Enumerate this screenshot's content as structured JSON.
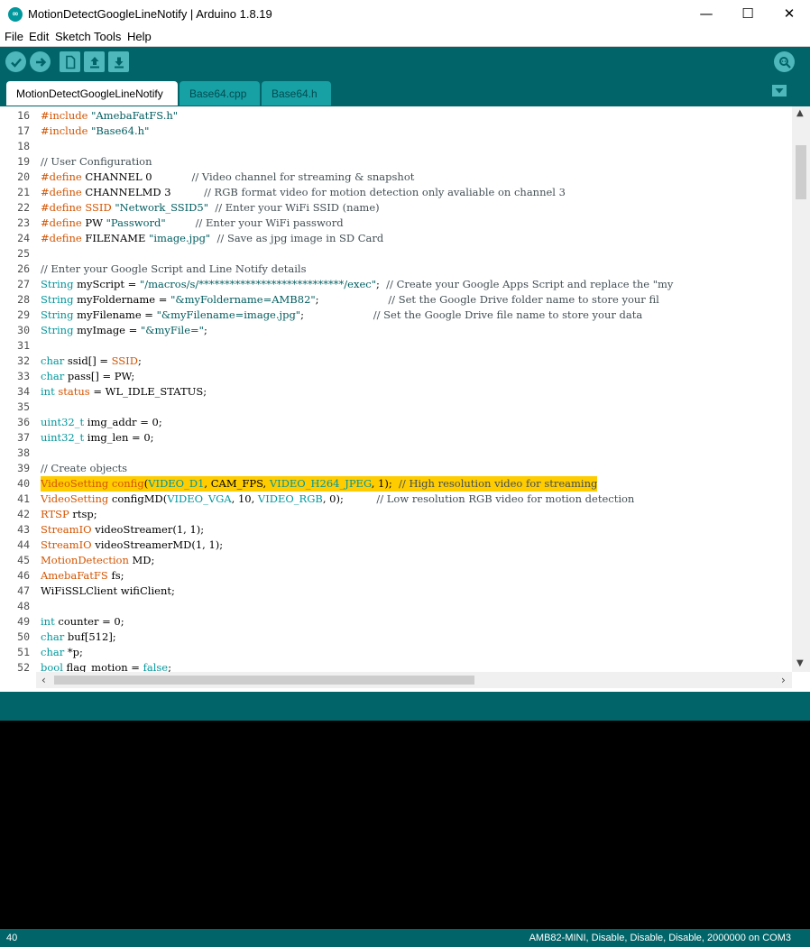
{
  "window": {
    "title": "MotionDetectGoogleLineNotify | Arduino 1.8.19",
    "app_icon_glyph": "∞",
    "minimize_glyph": "—",
    "maximize_glyph": "☐",
    "close_glyph": "✕"
  },
  "menu": [
    "File",
    "Edit",
    "Sketch",
    "Tools",
    "Help"
  ],
  "toolbar": {
    "icons": [
      "verify-icon",
      "upload-icon",
      "new-icon",
      "open-icon",
      "save-icon",
      "serial-monitor-icon"
    ]
  },
  "tabs": [
    {
      "label": "MotionDetectGoogleLineNotify",
      "active": true
    },
    {
      "label": "Base64.cpp",
      "active": false
    },
    {
      "label": "Base64.h",
      "active": false
    }
  ],
  "editor": {
    "highlighted_line": 40,
    "lines": [
      {
        "n": 16,
        "tokens": [
          {
            "t": "#include ",
            "c": "kw"
          },
          {
            "t": "\"AmebaFatFS.h\"",
            "c": "st"
          }
        ]
      },
      {
        "n": 17,
        "tokens": [
          {
            "t": "#include ",
            "c": "kw"
          },
          {
            "t": "\"Base64.h\"",
            "c": "st"
          }
        ]
      },
      {
        "n": 18,
        "tokens": []
      },
      {
        "n": 19,
        "tokens": [
          {
            "t": "// User Configuration",
            "c": "cm"
          }
        ]
      },
      {
        "n": 20,
        "tokens": [
          {
            "t": "#define ",
            "c": "kw"
          },
          {
            "t": "CHANNEL 0            ",
            "c": ""
          },
          {
            "t": "// Video channel for streaming & snapshot",
            "c": "cm"
          }
        ]
      },
      {
        "n": 21,
        "tokens": [
          {
            "t": "#define ",
            "c": "kw"
          },
          {
            "t": "CHANNELMD 3          ",
            "c": ""
          },
          {
            "t": "// RGB format video for motion detection only avaliable on channel 3",
            "c": "cm"
          }
        ]
      },
      {
        "n": 22,
        "tokens": [
          {
            "t": "#define ",
            "c": "kw"
          },
          {
            "t": "SSID ",
            "c": "kw"
          },
          {
            "t": "\"Network_SSID5\"",
            "c": "st"
          },
          {
            "t": "  ",
            "c": ""
          },
          {
            "t": "// Enter your WiFi SSID (name)",
            "c": "cm"
          }
        ]
      },
      {
        "n": 23,
        "tokens": [
          {
            "t": "#define ",
            "c": "kw"
          },
          {
            "t": "PW ",
            "c": ""
          },
          {
            "t": "\"Password\"",
            "c": "st"
          },
          {
            "t": "         ",
            "c": ""
          },
          {
            "t": "// Enter your WiFi password",
            "c": "cm"
          }
        ]
      },
      {
        "n": 24,
        "tokens": [
          {
            "t": "#define ",
            "c": "kw"
          },
          {
            "t": "FILENAME ",
            "c": ""
          },
          {
            "t": "\"image.jpg\"",
            "c": "st"
          },
          {
            "t": "  ",
            "c": ""
          },
          {
            "t": "// Save as jpg image in SD Card",
            "c": "cm"
          }
        ]
      },
      {
        "n": 25,
        "tokens": []
      },
      {
        "n": 26,
        "tokens": [
          {
            "t": "// Enter your Google Script and Line Notify details",
            "c": "cm"
          }
        ]
      },
      {
        "n": 27,
        "tokens": [
          {
            "t": "String ",
            "c": "kt"
          },
          {
            "t": "myScript = ",
            "c": ""
          },
          {
            "t": "\"/macros/s/****************************/exec\"",
            "c": "st"
          },
          {
            "t": ";  ",
            "c": ""
          },
          {
            "t": "// Create your Google Apps Script and replace the \"my",
            "c": "cm"
          }
        ]
      },
      {
        "n": 28,
        "tokens": [
          {
            "t": "String ",
            "c": "kt"
          },
          {
            "t": "myFoldername = ",
            "c": ""
          },
          {
            "t": "\"&myFoldername=AMB82\"",
            "c": "st"
          },
          {
            "t": ";                     ",
            "c": ""
          },
          {
            "t": "// Set the Google Drive folder name to store your fil",
            "c": "cm"
          }
        ]
      },
      {
        "n": 29,
        "tokens": [
          {
            "t": "String ",
            "c": "kt"
          },
          {
            "t": "myFilename = ",
            "c": ""
          },
          {
            "t": "\"&myFilename=image.jpg\"",
            "c": "st"
          },
          {
            "t": ";                     ",
            "c": ""
          },
          {
            "t": "// Set the Google Drive file name to store your data",
            "c": "cm"
          }
        ]
      },
      {
        "n": 30,
        "tokens": [
          {
            "t": "String ",
            "c": "kt"
          },
          {
            "t": "myImage = ",
            "c": ""
          },
          {
            "t": "\"&myFile=\"",
            "c": "st"
          },
          {
            "t": ";",
            "c": ""
          }
        ]
      },
      {
        "n": 31,
        "tokens": []
      },
      {
        "n": 32,
        "tokens": [
          {
            "t": "char ",
            "c": "kt"
          },
          {
            "t": "ssid[] = ",
            "c": ""
          },
          {
            "t": "SSID",
            "c": "kw"
          },
          {
            "t": ";",
            "c": ""
          }
        ]
      },
      {
        "n": 33,
        "tokens": [
          {
            "t": "char ",
            "c": "kt"
          },
          {
            "t": "pass[] = PW;",
            "c": ""
          }
        ]
      },
      {
        "n": 34,
        "tokens": [
          {
            "t": "int ",
            "c": "kt"
          },
          {
            "t": "status",
            "c": "kw"
          },
          {
            "t": " = WL_IDLE_STATUS;",
            "c": ""
          }
        ]
      },
      {
        "n": 35,
        "tokens": []
      },
      {
        "n": 36,
        "tokens": [
          {
            "t": "uint32_t ",
            "c": "kt"
          },
          {
            "t": "img_addr = 0;",
            "c": ""
          }
        ]
      },
      {
        "n": 37,
        "tokens": [
          {
            "t": "uint32_t ",
            "c": "kt"
          },
          {
            "t": "img_len = 0;",
            "c": ""
          }
        ]
      },
      {
        "n": 38,
        "tokens": []
      },
      {
        "n": 39,
        "tokens": [
          {
            "t": "// Create objects",
            "c": "cm"
          }
        ]
      },
      {
        "n": 40,
        "tokens": [
          {
            "t": "VideoSetting ",
            "c": "kw"
          },
          {
            "t": "config",
            "c": "kw"
          },
          {
            "t": "(",
            "c": ""
          },
          {
            "t": "VIDEO_D1",
            "c": "cn"
          },
          {
            "t": ", CAM_FPS, ",
            "c": ""
          },
          {
            "t": "VIDEO_H264_JPEG",
            "c": "cn"
          },
          {
            "t": ", 1);  ",
            "c": ""
          },
          {
            "t": "// High resolution video for streaming",
            "c": "cm"
          }
        ]
      },
      {
        "n": 41,
        "tokens": [
          {
            "t": "VideoSetting ",
            "c": "kw"
          },
          {
            "t": "configMD(",
            "c": ""
          },
          {
            "t": "VIDEO_VGA",
            "c": "cn"
          },
          {
            "t": ", 10, ",
            "c": ""
          },
          {
            "t": "VIDEO_RGB",
            "c": "cn"
          },
          {
            "t": ", 0);          ",
            "c": ""
          },
          {
            "t": "// Low resolution RGB video for motion detection",
            "c": "cm"
          }
        ]
      },
      {
        "n": 42,
        "tokens": [
          {
            "t": "RTSP ",
            "c": "kw"
          },
          {
            "t": "rtsp;",
            "c": ""
          }
        ]
      },
      {
        "n": 43,
        "tokens": [
          {
            "t": "StreamIO ",
            "c": "kw"
          },
          {
            "t": "videoStreamer(1, 1);",
            "c": ""
          }
        ]
      },
      {
        "n": 44,
        "tokens": [
          {
            "t": "StreamIO ",
            "c": "kw"
          },
          {
            "t": "videoStreamerMD(1, 1);",
            "c": ""
          }
        ]
      },
      {
        "n": 45,
        "tokens": [
          {
            "t": "MotionDetection ",
            "c": "kw"
          },
          {
            "t": "MD;",
            "c": ""
          }
        ]
      },
      {
        "n": 46,
        "tokens": [
          {
            "t": "AmebaFatFS ",
            "c": "kw"
          },
          {
            "t": "fs;",
            "c": ""
          }
        ]
      },
      {
        "n": 47,
        "tokens": [
          {
            "t": "WiFiSSLClient wifiClient;",
            "c": ""
          }
        ]
      },
      {
        "n": 48,
        "tokens": []
      },
      {
        "n": 49,
        "tokens": [
          {
            "t": "int ",
            "c": "kt"
          },
          {
            "t": "counter = 0;",
            "c": ""
          }
        ]
      },
      {
        "n": 50,
        "tokens": [
          {
            "t": "char ",
            "c": "kt"
          },
          {
            "t": "buf[512];",
            "c": ""
          }
        ]
      },
      {
        "n": 51,
        "tokens": [
          {
            "t": "char ",
            "c": "kt"
          },
          {
            "t": "*p;",
            "c": ""
          }
        ]
      },
      {
        "n": 52,
        "tokens": [
          {
            "t": "bool ",
            "c": "kt"
          },
          {
            "t": "flag_motion = ",
            "c": ""
          },
          {
            "t": "false",
            "c": "kt"
          },
          {
            "t": ";",
            "c": ""
          }
        ]
      }
    ]
  },
  "footer": {
    "line_number": "40",
    "board": "AMB82-MINI, Disable, Disable, Disable, 2000000 on COM3"
  },
  "colors": {
    "teal_dark": "#006468",
    "teal_button": "#4db7bb",
    "highlight": "#ffcc00",
    "keyword": "#d35400",
    "type": "#00979c"
  }
}
